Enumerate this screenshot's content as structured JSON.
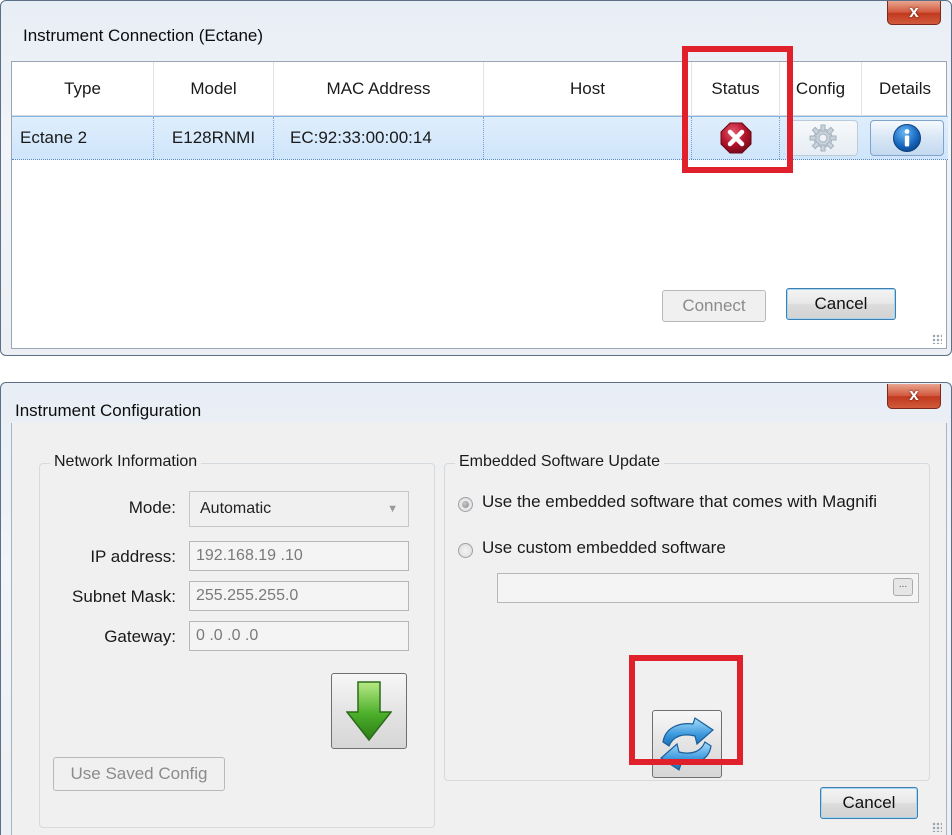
{
  "connection_window": {
    "title": "Instrument Connection (Ectane)",
    "close_glyph": "x",
    "columns": [
      "Type",
      "Model",
      "MAC Address",
      "Host",
      "Status",
      "Config",
      "Details"
    ],
    "row": {
      "type": "Ectane 2",
      "model": "E128RNMI",
      "mac": "EC:92:33:00:00:14",
      "host": "",
      "status_icon": "error-x-octagon-icon",
      "config_icon": "gear-icon",
      "details_icon": "info-icon"
    },
    "connect_label": "Connect",
    "cancel_label": "Cancel",
    "highlight_color": "#e0212b"
  },
  "config_window": {
    "title": "Instrument Configuration",
    "close_glyph": "x",
    "network": {
      "legend": "Network Information",
      "mode_label": "Mode:",
      "mode_value": "Automatic",
      "ip_label": "IP address:",
      "ip_value": "192.168.19 .10",
      "subnet_label": "Subnet Mask:",
      "subnet_value": "255.255.255.0",
      "gateway_label": "Gateway:",
      "gateway_value": "0  .0  .0  .0",
      "use_saved_label": "Use Saved Config",
      "download_icon": "green-down-arrow-icon"
    },
    "software": {
      "legend": "Embedded Software Update",
      "option_default": "Use the embedded software that comes with Magnifi",
      "option_custom": "Use custom embedded software",
      "custom_path": "",
      "browse_label": "...",
      "update_icon": "refresh-arrows-icon"
    },
    "cancel_label": "Cancel"
  }
}
